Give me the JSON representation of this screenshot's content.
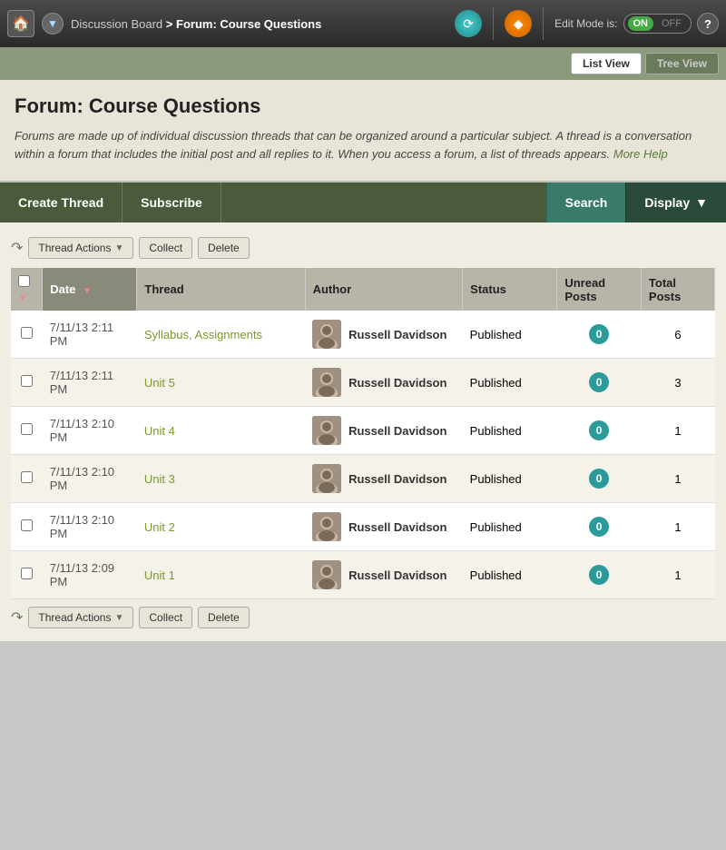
{
  "topNav": {
    "breadcrumb_home": "Discussion Board",
    "breadcrumb_separator": " > ",
    "breadcrumb_current": "Forum: Course Questions",
    "edit_mode_label": "Edit Mode is:",
    "toggle_on": "ON",
    "toggle_off": "OFF",
    "help_label": "?"
  },
  "viewToggle": {
    "list_view_label": "List View",
    "tree_view_label": "Tree View"
  },
  "forumHeader": {
    "title": "Forum: Course Questions",
    "description": "Forums are made up of individual discussion threads that can be organized around a particular subject. A thread is a conversation within a forum that includes the initial post and all replies to it. When you access a forum, a list of threads appears.",
    "more_help_label": "More Help"
  },
  "toolbar": {
    "create_thread_label": "Create Thread",
    "subscribe_label": "Subscribe",
    "search_label": "Search",
    "display_label": "Display"
  },
  "actionBar": {
    "thread_actions_label": "Thread Actions",
    "collect_label": "Collect",
    "delete_label": "Delete"
  },
  "table": {
    "col_date": "Date",
    "col_thread": "Thread",
    "col_author": "Author",
    "col_status": "Status",
    "col_unread_posts": "Unread Posts",
    "col_total_posts": "Total Posts",
    "rows": [
      {
        "date": "7/11/13 2:11 PM",
        "thread": "Syllabus, Assignments",
        "author": "Russell Davidson",
        "status": "Published",
        "unread": 0,
        "total": 6
      },
      {
        "date": "7/11/13 2:11 PM",
        "thread": "Unit 5",
        "author": "Russell Davidson",
        "status": "Published",
        "unread": 0,
        "total": 3
      },
      {
        "date": "7/11/13 2:10 PM",
        "thread": "Unit 4",
        "author": "Russell Davidson",
        "status": "Published",
        "unread": 0,
        "total": 1
      },
      {
        "date": "7/11/13 2:10 PM",
        "thread": "Unit 3",
        "author": "Russell Davidson",
        "status": "Published",
        "unread": 0,
        "total": 1
      },
      {
        "date": "7/11/13 2:10 PM",
        "thread": "Unit 2",
        "author": "Russell Davidson",
        "status": "Published",
        "unread": 0,
        "total": 1
      },
      {
        "date": "7/11/13 2:09 PM",
        "thread": "Unit 1",
        "author": "Russell Davidson",
        "status": "Published",
        "unread": 0,
        "total": 1
      }
    ]
  }
}
